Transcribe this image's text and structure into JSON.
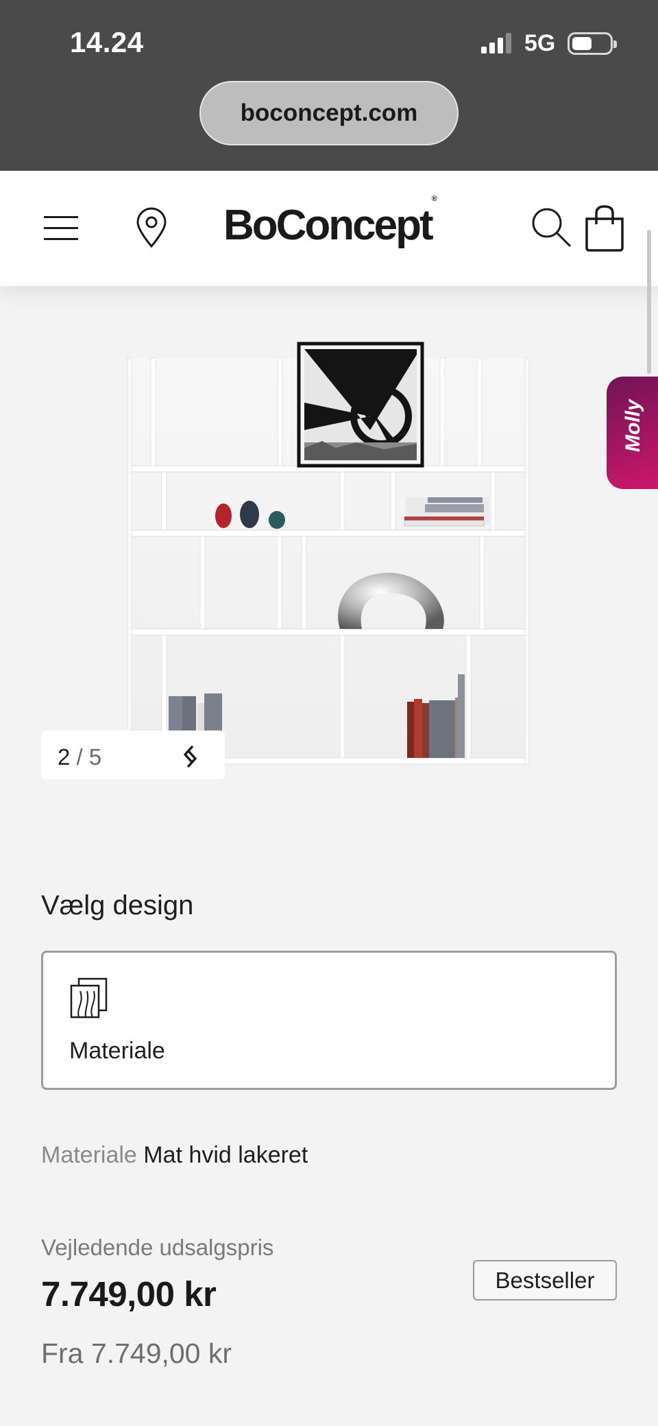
{
  "status_bar": {
    "time": "14.24",
    "network": "5G",
    "url": "boconcept.com"
  },
  "header": {
    "logo_text": "BoConcept",
    "logo_mark": "®",
    "icons": [
      "menu-icon",
      "location-pin-icon",
      "search-icon",
      "shopping-bag-icon"
    ]
  },
  "gallery": {
    "current": "2",
    "separator": " / ",
    "total": "5",
    "chat_label": "Molly"
  },
  "design": {
    "title": "Vælg design",
    "option_label": "Materiale",
    "option_icon": "material-swatch-icon"
  },
  "material": {
    "key": "Materiale",
    "value": "Mat hvid lakeret"
  },
  "pricing": {
    "label": "Vejledende udsalgspris",
    "price": "7.749,00 kr",
    "from_price": "Fra 7.749,00 kr",
    "badge": "Bestseller"
  },
  "colors": {
    "status_bar_bg": "#4a4a4a",
    "page_bg": "#f3f3f4",
    "chat_accent": "#b0155f"
  }
}
